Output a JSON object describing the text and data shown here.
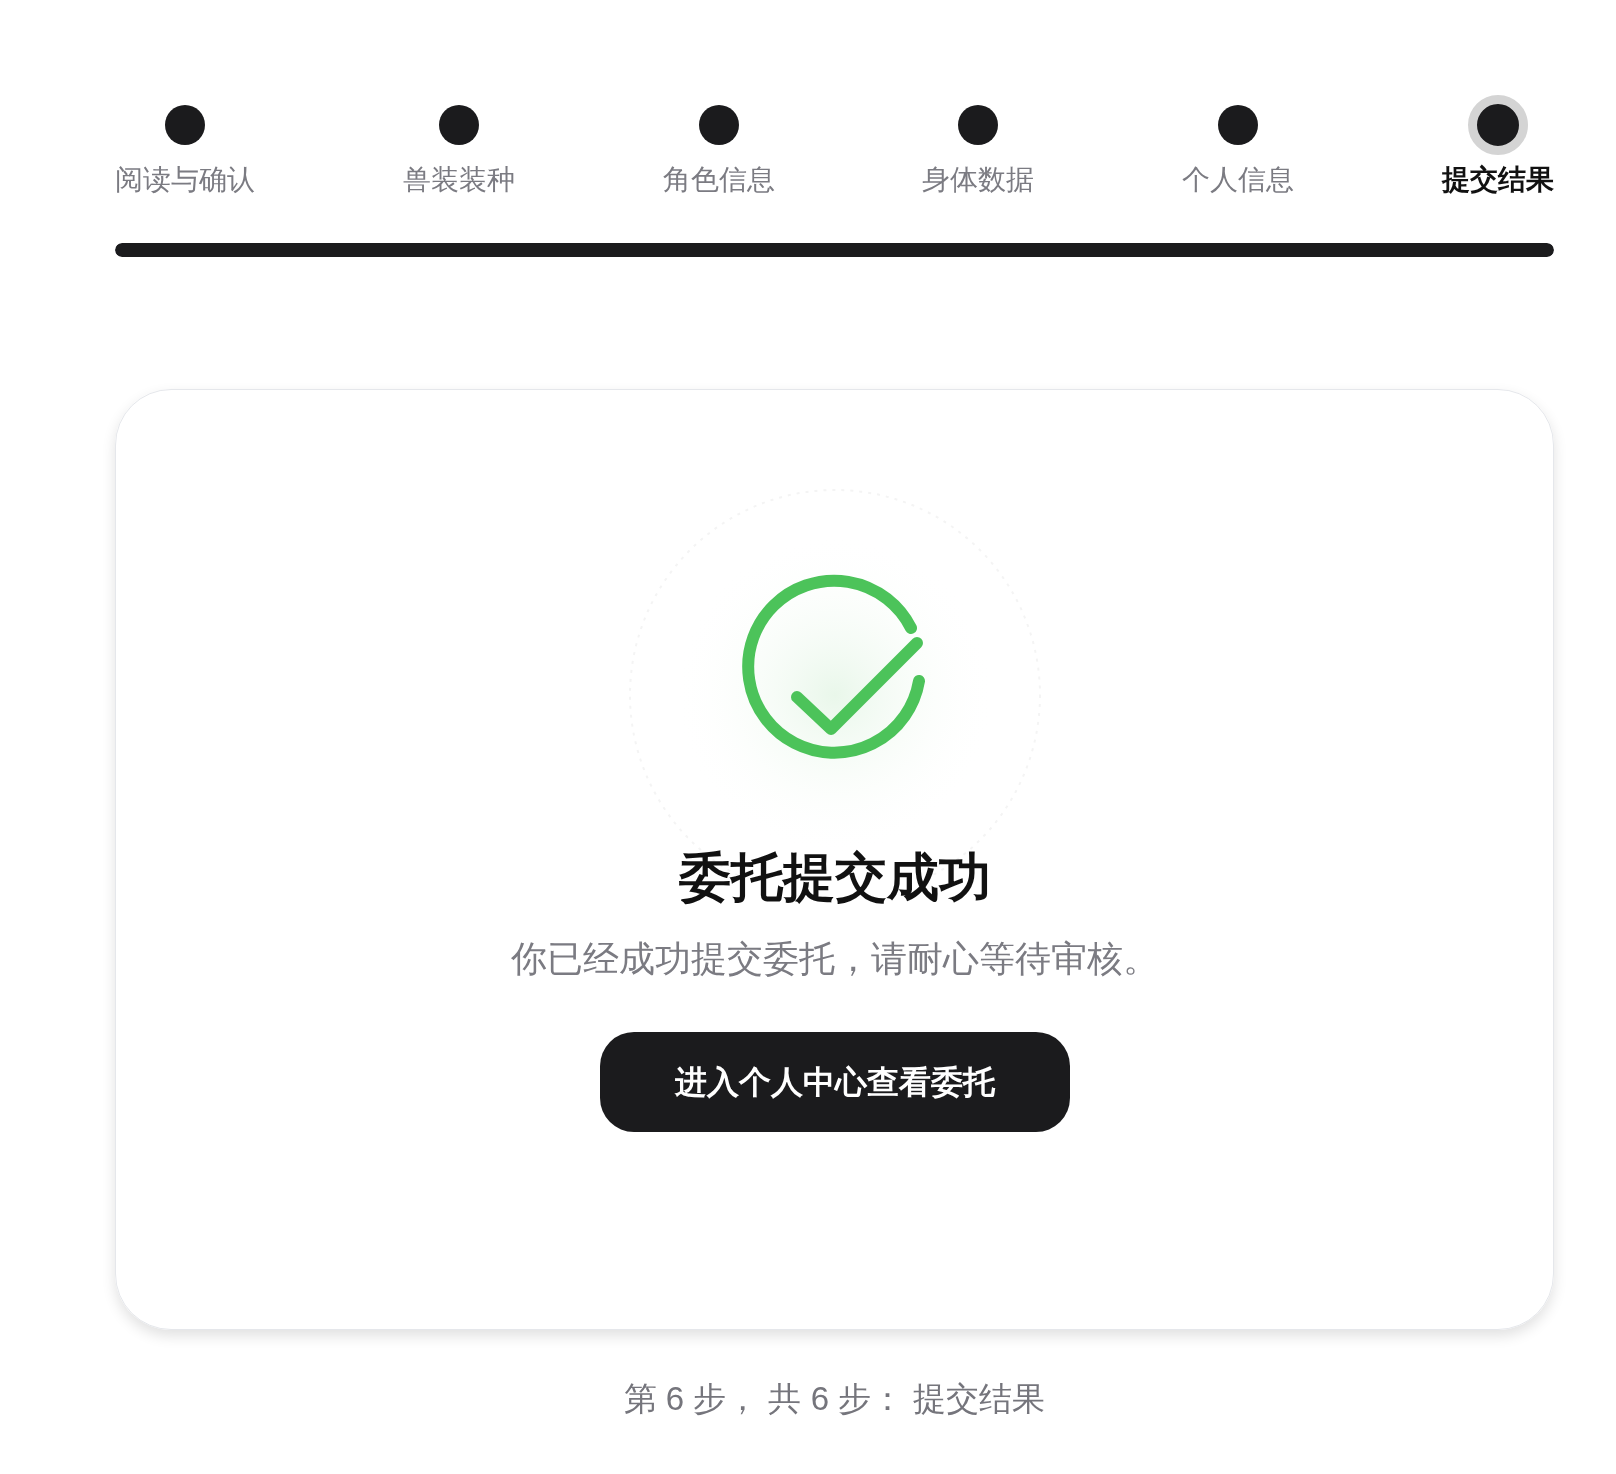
{
  "steps": [
    {
      "label": "阅读与确认",
      "selected": false
    },
    {
      "label": "兽装装种",
      "selected": false
    },
    {
      "label": "角色信息",
      "selected": false
    },
    {
      "label": "身体数据",
      "selected": false
    },
    {
      "label": "个人信息",
      "selected": false
    },
    {
      "label": "提交结果",
      "selected": true
    }
  ],
  "progress": {
    "level": 1
  },
  "result": {
    "title": "委托提交成功",
    "message": "你已经成功提交委托，请耐心等待审核。",
    "button": "进入个人中心查看委托"
  },
  "footer": "第 6 步， 共 6 步： 提交结果"
}
